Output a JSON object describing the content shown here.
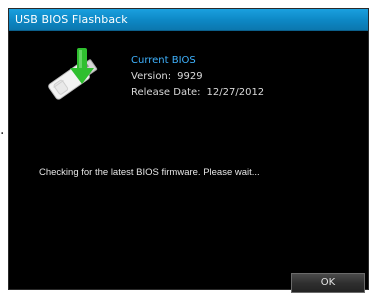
{
  "stray_text": ".",
  "window": {
    "title": "USB BIOS Flashback"
  },
  "bios": {
    "heading": "Current BIOS",
    "version_label": "Version:",
    "version_value": "9929",
    "release_label": "Release Date:",
    "release_value": "12/27/2012"
  },
  "status_message": "Checking for the latest BIOS  firmware. Please wait...",
  "buttons": {
    "ok_label": "OK"
  },
  "icons": {
    "usb": "usb-flash-drive-with-green-down-arrow-icon"
  },
  "colors": {
    "titlebar": "#0d87c4",
    "dialog_bg": "#000000",
    "heading_blue": "#3fb3ff",
    "arrow_green": "#2fbf2f",
    "text": "#d9d9d9"
  }
}
